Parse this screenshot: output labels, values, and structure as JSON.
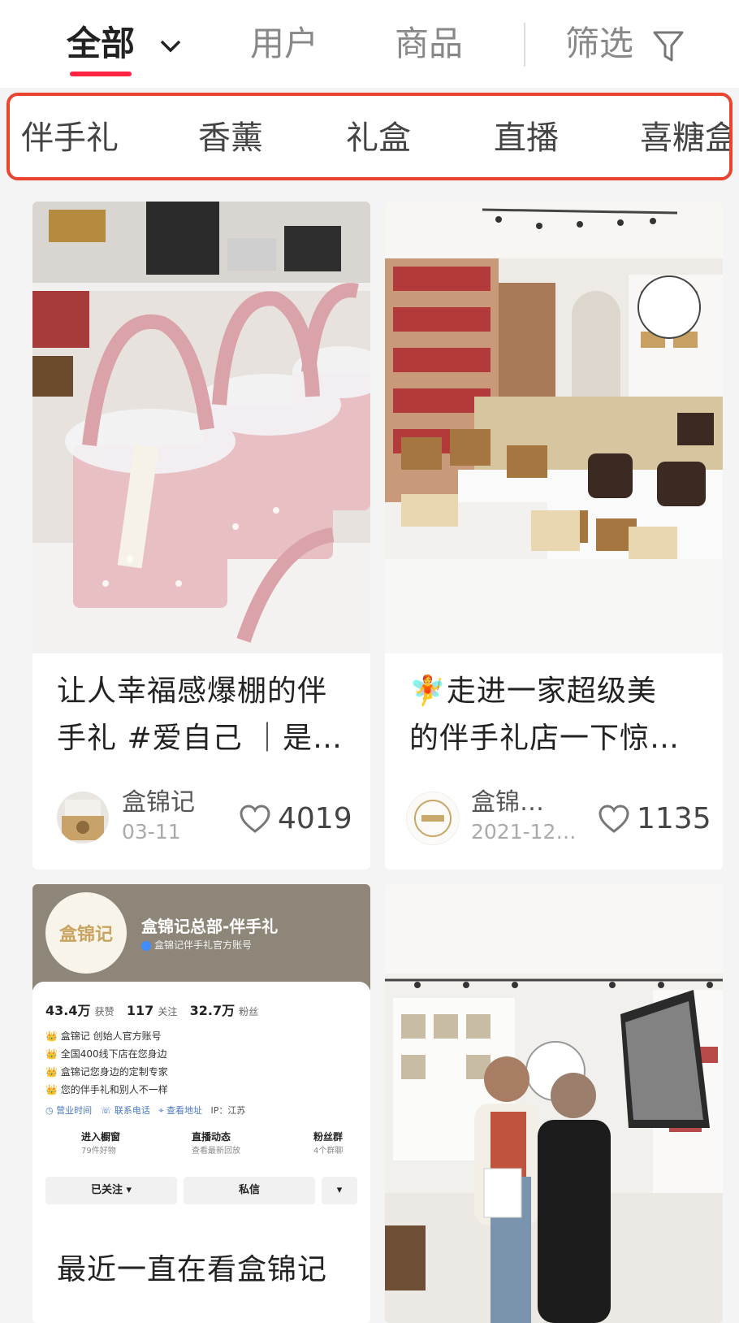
{
  "tabs": {
    "all": "全部",
    "users": "用户",
    "products": "商品",
    "filter": "筛选"
  },
  "chips": [
    "伴手礼",
    "香薰",
    "礼盒",
    "直播",
    "喜糖盒"
  ],
  "colors": {
    "accent": "#ff2442",
    "highlight_border": "#e8442f"
  },
  "cards": [
    {
      "title_line1": "让人幸福感爆棚的伴",
      "title_line2": "手礼 #爱自己 ｜是…",
      "author": "盒锦记",
      "date": "03-11",
      "likes": "4019"
    },
    {
      "emoji": "🧚",
      "title_line1": "走进一家超级美",
      "title_line2": "的伴手礼店一下惊…",
      "author": "盒锦…",
      "date": "2021-12…",
      "likes": "1135"
    },
    {
      "title_line1": "最近一直在看盒锦记",
      "profile": {
        "logo_text": "盒锦记",
        "name": "盒锦记总部-伴手礼",
        "verify": "盒锦记伴手礼官方账号",
        "stats": [
          {
            "num": "43.4万",
            "label": "获赞"
          },
          {
            "num": "117",
            "label": "关注"
          },
          {
            "num": "32.7万",
            "label": "粉丝"
          }
        ],
        "bio": [
          "盒锦记 创始人官方账号",
          "全国400线下店在您身边",
          "盒锦记您身边的定制专家",
          "您的伴手礼和别人不一样"
        ],
        "info": [
          "营业时间",
          "联系电话",
          "查看地址",
          "IP：江苏"
        ],
        "actions": [
          {
            "t": "进入橱窗",
            "s": "79件好物"
          },
          {
            "t": "直播动态",
            "s": "查看最新回放"
          },
          {
            "t": "粉丝群",
            "s": "4个群聊"
          }
        ],
        "follow": "已关注 ▾",
        "message": "私信",
        "more": "▾"
      }
    },
    {
      "image_only": true
    }
  ],
  "icons": [
    "chevron-down-icon",
    "filter-icon",
    "heart-icon"
  ]
}
